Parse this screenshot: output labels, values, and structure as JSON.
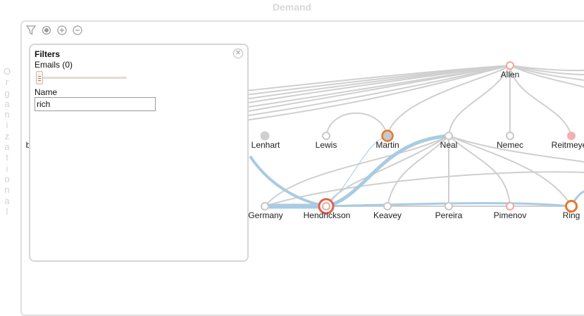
{
  "chart_title": "Demand",
  "y_axis_label": "Organizational",
  "toolbar": [
    {
      "name": "filter-icon"
    },
    {
      "name": "target-icon"
    },
    {
      "name": "zoom-in-icon"
    },
    {
      "name": "zoom-out-icon"
    }
  ],
  "filter_panel": {
    "title": "Filters",
    "emails_label": "Emails (0)",
    "emails_value": 0,
    "name_label": "Name",
    "name_value": "rich"
  },
  "graph": {
    "nodes": [
      {
        "id": "Allen",
        "label": "Allen",
        "style": "salmon-ring"
      },
      {
        "id": "Lenhart",
        "label": "Lenhart",
        "style": "grey-filled"
      },
      {
        "id": "Lewis",
        "label": "Lewis",
        "style": "grey-ring"
      },
      {
        "id": "Martin",
        "label": "Martin",
        "style": "orange-ring-grey"
      },
      {
        "id": "Neal",
        "label": "Neal",
        "style": "grey-ring"
      },
      {
        "id": "Nemec",
        "label": "Nemec",
        "style": "grey-ring"
      },
      {
        "id": "Reitmeyer",
        "label": "Reitmeye",
        "style": "pink-filled"
      },
      {
        "id": "Germany",
        "label": "Germany",
        "style": "grey-ring"
      },
      {
        "id": "Hendrickson",
        "label": "Hendrickson",
        "style": "red-ring-large"
      },
      {
        "id": "Keavey",
        "label": "Keavey",
        "style": "grey-ring"
      },
      {
        "id": "Pereira",
        "label": "Pereira",
        "style": "grey-ring"
      },
      {
        "id": "Pimenov",
        "label": "Pimenov",
        "style": "salmon-ring"
      },
      {
        "id": "Ring",
        "label": "Ring",
        "style": "orange-ring"
      },
      {
        "id": "left_b",
        "label": "b",
        "style": "hidden"
      }
    ]
  },
  "colors": {
    "edge_grey": "#cfcfcf",
    "edge_blue": "#a9cbe3",
    "accent_orange": "#e8762b",
    "accent_red": "#e0604c"
  }
}
